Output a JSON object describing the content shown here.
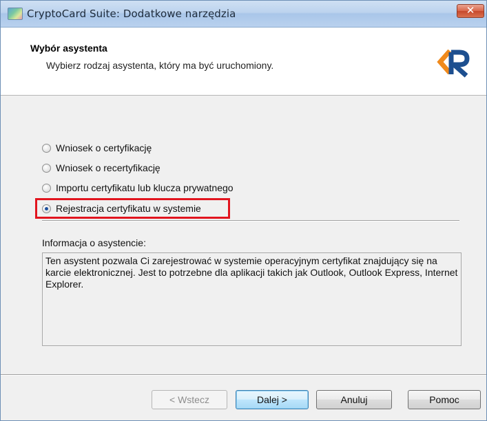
{
  "window": {
    "title": "CryptoCard Suite: Dodatkowe narzędzia",
    "close_glyph": "✕"
  },
  "header": {
    "title": "Wybór asystenta",
    "subtitle": "Wybierz rodzaj asystenta, który ma być uruchomiony.",
    "logo_icon": "kir-logo-icon"
  },
  "options": [
    {
      "label": "Wniosek o certyfikację",
      "checked": false
    },
    {
      "label": "Wniosek o recertyfikację",
      "checked": false
    },
    {
      "label": "Importu certyfikatu lub klucza prywatnego",
      "checked": false
    },
    {
      "label": "Rejestracja certyfikatu w systemie",
      "checked": true
    }
  ],
  "info": {
    "label": "Informacja o asystencie:",
    "text": "Ten asystent pozwala Ci zarejestrować w systemie operacyjnym certyfikat znajdujący się na karcie elektronicznej. Jest to potrzebne dla aplikacji takich jak Outlook, Outlook Express, Internet Explorer."
  },
  "buttons": {
    "back": "< Wstecz",
    "next": "Dalej >",
    "cancel": "Anuluj",
    "help": "Pomoc"
  },
  "colors": {
    "highlight": "#e2141e",
    "logo_orange": "#f08a1c",
    "logo_blue": "#1d4f8f"
  }
}
